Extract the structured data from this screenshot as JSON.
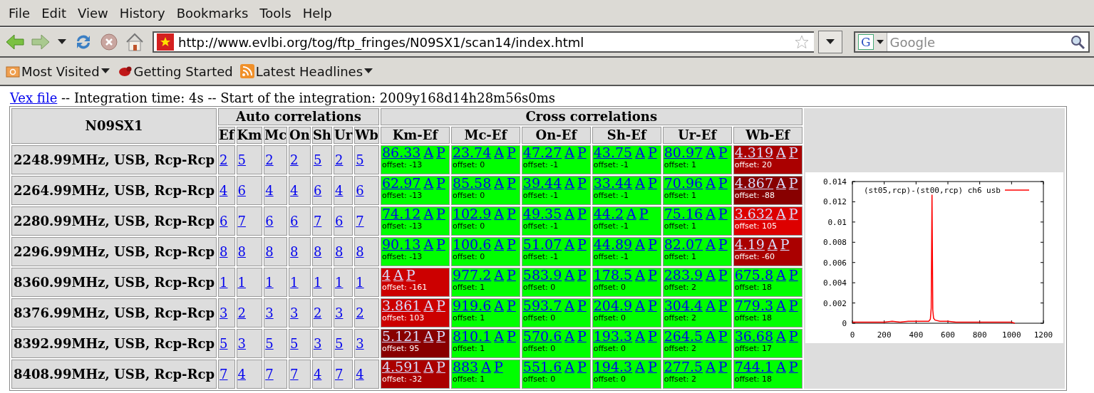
{
  "menu": [
    {
      "label": "File"
    },
    {
      "label": "Edit"
    },
    {
      "label": "View"
    },
    {
      "label": "History"
    },
    {
      "label": "Bookmarks"
    },
    {
      "label": "Tools"
    },
    {
      "label": "Help"
    }
  ],
  "address": {
    "url": "http://www.evlbi.org/tog/ftp_fringes/N09SX1/scan14/index.html"
  },
  "search": {
    "engine": "G",
    "placeholder": "Google"
  },
  "bookmarks": [
    {
      "label": "Most Visited",
      "dropdown": true
    },
    {
      "label": "Getting Started",
      "dropdown": false
    },
    {
      "label": "Latest Headlines",
      "dropdown": true
    }
  ],
  "page": {
    "vex_link": "Vex file",
    "info": " -- Integration time: 4s -- Start of the integration: 2009y168d14h28m56s0ms"
  },
  "table": {
    "title": "N09SX1",
    "auto_header": "Auto correlations",
    "cross_header": "Cross correlations",
    "auto_columns": [
      "Ef",
      "Km",
      "Mc",
      "On",
      "Sh",
      "Ur",
      "Wb"
    ],
    "cross_columns": [
      "Km-Ef",
      "Mc-Ef",
      "On-Ef",
      "Sh-Ef",
      "Ur-Ef",
      "Wb-Ef"
    ],
    "rows": [
      {
        "label": "2248.99MHz, USB, Rcp-Rcp",
        "auto": [
          "2",
          "5",
          "2",
          "2",
          "5",
          "2",
          "5"
        ],
        "cross": [
          {
            "value": "86.33",
            "links": [
              "A",
              "P"
            ],
            "offset": "offset: -13",
            "color": "#00ff00"
          },
          {
            "value": "23.74",
            "links": [
              "A",
              "P"
            ],
            "offset": "offset: 0",
            "color": "#00ff00"
          },
          {
            "value": "47.27",
            "links": [
              "A",
              "P"
            ],
            "offset": "offset: -1",
            "color": "#00ff00"
          },
          {
            "value": "43.75",
            "links": [
              "A",
              "P"
            ],
            "offset": "offset: -1",
            "color": "#00ff00"
          },
          {
            "value": "80.97",
            "links": [
              "A",
              "P"
            ],
            "offset": "offset: 1",
            "color": "#00ff00"
          },
          {
            "value": "4.319",
            "links": [
              "A",
              "P"
            ],
            "offset": "offset: 20",
            "color": "#aa0000"
          }
        ]
      },
      {
        "label": "2264.99MHz, USB, Rcp-Rcp",
        "auto": [
          "4",
          "6",
          "4",
          "4",
          "6",
          "4",
          "6"
        ],
        "cross": [
          {
            "value": "62.97",
            "links": [
              "A",
              "P"
            ],
            "offset": "offset: -13",
            "color": "#00ff00"
          },
          {
            "value": "85.58",
            "links": [
              "A",
              "P"
            ],
            "offset": "offset: 0",
            "color": "#00ff00"
          },
          {
            "value": "39.44",
            "links": [
              "A",
              "P"
            ],
            "offset": "offset: -1",
            "color": "#00ff00"
          },
          {
            "value": "33.44",
            "links": [
              "A",
              "P"
            ],
            "offset": "offset: -1",
            "color": "#00ff00"
          },
          {
            "value": "70.96",
            "links": [
              "A",
              "P"
            ],
            "offset": "offset: 1",
            "color": "#00ff00"
          },
          {
            "value": "4.867",
            "links": [
              "A",
              "P"
            ],
            "offset": "offset: -88",
            "color": "#880000"
          }
        ]
      },
      {
        "label": "2280.99MHz, USB, Rcp-Rcp",
        "auto": [
          "6",
          "7",
          "6",
          "6",
          "7",
          "6",
          "7"
        ],
        "cross": [
          {
            "value": "74.12",
            "links": [
              "A",
              "P"
            ],
            "offset": "offset: -13",
            "color": "#00ff00"
          },
          {
            "value": "102.9",
            "links": [
              "A",
              "P"
            ],
            "offset": "offset: 0",
            "color": "#00ff00"
          },
          {
            "value": "49.35",
            "links": [
              "A",
              "P"
            ],
            "offset": "offset: -1",
            "color": "#00ff00"
          },
          {
            "value": "44.2",
            "links": [
              "A",
              "P"
            ],
            "offset": "offset: -1",
            "color": "#00ff00"
          },
          {
            "value": "75.16",
            "links": [
              "A",
              "P"
            ],
            "offset": "offset: 1",
            "color": "#00ff00"
          },
          {
            "value": "3.632",
            "links": [
              "A",
              "P"
            ],
            "offset": "offset: 105",
            "color": "#dd0000"
          }
        ]
      },
      {
        "label": "2296.99MHz, USB, Rcp-Rcp",
        "auto": [
          "8",
          "8",
          "8",
          "8",
          "8",
          "8",
          "8"
        ],
        "cross": [
          {
            "value": "90.13",
            "links": [
              "A",
              "P"
            ],
            "offset": "offset: -13",
            "color": "#00ff00"
          },
          {
            "value": "100.6",
            "links": [
              "A",
              "P"
            ],
            "offset": "offset: 0",
            "color": "#00ff00"
          },
          {
            "value": "51.07",
            "links": [
              "A",
              "P"
            ],
            "offset": "offset: -1",
            "color": "#00ff00"
          },
          {
            "value": "44.89",
            "links": [
              "A",
              "P"
            ],
            "offset": "offset: -1",
            "color": "#00ff00"
          },
          {
            "value": "82.07",
            "links": [
              "A",
              "P"
            ],
            "offset": "offset: 1",
            "color": "#00ff00"
          },
          {
            "value": "4.19",
            "links": [
              "A",
              "P"
            ],
            "offset": "offset: -60",
            "color": "#aa0000"
          }
        ]
      },
      {
        "label": "8360.99MHz, USB, Rcp-Rcp",
        "auto": [
          "1",
          "1",
          "1",
          "1",
          "1",
          "1",
          "1"
        ],
        "cross": [
          {
            "value": "4",
            "links": [
              "A",
              "P"
            ],
            "offset": "offset: -161",
            "color": "#cc0000"
          },
          {
            "value": "977.2",
            "links": [
              "A",
              "P"
            ],
            "offset": "offset: 1",
            "color": "#00ff00"
          },
          {
            "value": "583.9",
            "links": [
              "A",
              "P"
            ],
            "offset": "offset: 0",
            "color": "#00ff00"
          },
          {
            "value": "178.5",
            "links": [
              "A",
              "P"
            ],
            "offset": "offset: 0",
            "color": "#00ff00"
          },
          {
            "value": "283.9",
            "links": [
              "A",
              "P"
            ],
            "offset": "offset: 2",
            "color": "#00ff00"
          },
          {
            "value": "675.8",
            "links": [
              "A",
              "P"
            ],
            "offset": "offset: 18",
            "color": "#00ff00"
          }
        ]
      },
      {
        "label": "8376.99MHz, USB, Rcp-Rcp",
        "auto": [
          "3",
          "2",
          "3",
          "3",
          "2",
          "3",
          "2"
        ],
        "cross": [
          {
            "value": "3.861",
            "links": [
              "A",
              "P"
            ],
            "offset": "offset: 103",
            "color": "#cc0000"
          },
          {
            "value": "919.6",
            "links": [
              "A",
              "P"
            ],
            "offset": "offset: 1",
            "color": "#00ff00"
          },
          {
            "value": "593.7",
            "links": [
              "A",
              "P"
            ],
            "offset": "offset: 0",
            "color": "#00ff00"
          },
          {
            "value": "204.9",
            "links": [
              "A",
              "P"
            ],
            "offset": "offset: 0",
            "color": "#00ff00"
          },
          {
            "value": "304.4",
            "links": [
              "A",
              "P"
            ],
            "offset": "offset: 2",
            "color": "#00ff00"
          },
          {
            "value": "779.3",
            "links": [
              "A",
              "P"
            ],
            "offset": "offset: 18",
            "color": "#00ff00"
          }
        ]
      },
      {
        "label": "8392.99MHz, USB, Rcp-Rcp",
        "auto": [
          "5",
          "3",
          "5",
          "5",
          "3",
          "5",
          "3"
        ],
        "cross": [
          {
            "value": "5.121",
            "links": [
              "A",
              "P"
            ],
            "offset": "offset: 95",
            "color": "#880000"
          },
          {
            "value": "810.1",
            "links": [
              "A",
              "P"
            ],
            "offset": "offset: 1",
            "color": "#00ff00"
          },
          {
            "value": "570.6",
            "links": [
              "A",
              "P"
            ],
            "offset": "offset: 0",
            "color": "#00ff00"
          },
          {
            "value": "193.3",
            "links": [
              "A",
              "P"
            ],
            "offset": "offset: 0",
            "color": "#00ff00"
          },
          {
            "value": "264.5",
            "links": [
              "A",
              "P"
            ],
            "offset": "offset: 2",
            "color": "#00ff00"
          },
          {
            "value": "36.68",
            "links": [
              "A",
              "P"
            ],
            "offset": "offset: 17",
            "color": "#00ff00"
          }
        ]
      },
      {
        "label": "8408.99MHz, USB, Rcp-Rcp",
        "auto": [
          "7",
          "4",
          "7",
          "7",
          "4",
          "7",
          "4"
        ],
        "cross": [
          {
            "value": "4.591",
            "links": [
              "A",
              "P"
            ],
            "offset": "offset: -32",
            "color": "#aa0000"
          },
          {
            "value": "883",
            "links": [
              "A",
              "P"
            ],
            "offset": "offset: 1",
            "color": "#00ff00"
          },
          {
            "value": "551.6",
            "links": [
              "A",
              "P"
            ],
            "offset": "offset: 0",
            "color": "#00ff00"
          },
          {
            "value": "194.3",
            "links": [
              "A",
              "P"
            ],
            "offset": "offset: 0",
            "color": "#00ff00"
          },
          {
            "value": "277.5",
            "links": [
              "A",
              "P"
            ],
            "offset": "offset: 2",
            "color": "#00ff00"
          },
          {
            "value": "744.1",
            "links": [
              "A",
              "P"
            ],
            "offset": "offset: 18",
            "color": "#00ff00"
          }
        ]
      }
    ]
  },
  "plot": {
    "chart_data": {
      "type": "line",
      "xlim": [
        0,
        1200
      ],
      "ylim": [
        0,
        0.014
      ],
      "xticks": [
        0,
        200,
        400,
        600,
        800,
        1000,
        1200
      ],
      "yticks": [
        0,
        0.002,
        0.004,
        0.006,
        0.008,
        0.01,
        0.012,
        0.014
      ],
      "x": [
        0,
        50,
        100,
        150,
        200,
        250,
        300,
        350,
        400,
        450,
        480,
        490,
        495,
        500,
        505,
        510,
        520,
        550,
        600,
        650,
        700,
        750,
        800,
        850,
        900,
        950,
        1000,
        1020
      ],
      "series": [
        {
          "name": "(st05,rcp)-(st00,rcp) ch6 usb",
          "color": "#ff0000",
          "values": [
            0.0001,
            0.0001,
            0.0001,
            0.0001,
            0.0001,
            0.0002,
            0.0001,
            0.0002,
            0.0002,
            0.0002,
            0.0002,
            0.0004,
            0.0015,
            0.0127,
            0.0013,
            0.0005,
            0.0003,
            0.0002,
            0.0002,
            0.0001,
            0.0001,
            0.0001,
            0.0001,
            0.0001,
            0.0001,
            0.0001,
            0.0001,
            0
          ]
        }
      ]
    }
  }
}
